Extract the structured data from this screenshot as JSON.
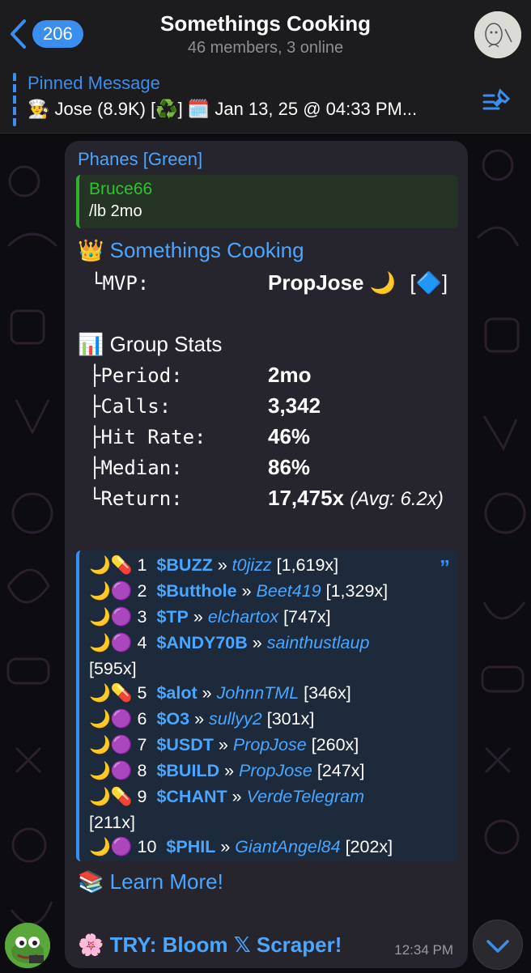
{
  "header": {
    "back_count": "206",
    "title": "Somethings Cooking",
    "subtitle": "46 members, 3 online"
  },
  "pinned": {
    "label": "Pinned Message",
    "text": "👨‍🍳 Jose (8.9K) [♻️] 🗓️ Jan 13, 25 @ 04:33 PM..."
  },
  "message": {
    "sender": "Phanes [Green]",
    "reply": {
      "name": "Bruce66",
      "text": "/lb 2mo"
    },
    "group_emoji": "👑",
    "group_name": "Somethings Cooking",
    "mvp": {
      "prefix": "└",
      "label": "MVP:",
      "value": "PropJose 🌙",
      "badge": "[🔷]"
    },
    "stats_emoji": "📊",
    "stats_title": "Group Stats",
    "stats": [
      {
        "prefix": "├",
        "label": "Period:",
        "value": "2mo"
      },
      {
        "prefix": "├",
        "label": "Calls:",
        "value": "3,342"
      },
      {
        "prefix": "├",
        "label": "Hit Rate:",
        "value": "46%"
      },
      {
        "prefix": "├",
        "label": "Median:",
        "value": "86%"
      },
      {
        "prefix": "└",
        "label": "Return:",
        "value": "17,475x",
        "extra": "(Avg: 6.2x)"
      }
    ],
    "leaderboard": [
      {
        "emojis": "🌙💊",
        "rank": "1",
        "ticker": "$BUZZ",
        "user": "t0jizz",
        "mult": "[1,619x]"
      },
      {
        "emojis": "🌙🟣",
        "rank": "2",
        "ticker": "$Butthole",
        "user": "Beet419",
        "mult": "[1,329x]"
      },
      {
        "emojis": "🌙🟣",
        "rank": "3",
        "ticker": "$TP",
        "user": "elchartox",
        "mult": "[747x]"
      },
      {
        "emojis": "🌙🟣",
        "rank": "4",
        "ticker": "$ANDY70B",
        "user": "sainthustlaup",
        "mult": "[595x]"
      },
      {
        "emojis": "🌙💊",
        "rank": "5",
        "ticker": "$alot",
        "user": "JohnnTML",
        "mult": "[346x]"
      },
      {
        "emojis": "🌙🟣",
        "rank": "6",
        "ticker": "$O3",
        "user": "sullyy2",
        "mult": "[301x]"
      },
      {
        "emojis": "🌙🟣",
        "rank": "7",
        "ticker": "$USDT",
        "user": "PropJose",
        "mult": "[260x]"
      },
      {
        "emojis": "🌙🟣",
        "rank": "8",
        "ticker": "$BUILD",
        "user": "PropJose",
        "mult": "[247x]"
      },
      {
        "emojis": "🌙💊",
        "rank": "9",
        "ticker": "$CHANT",
        "user": "VerdeTelegram",
        "mult": "[211x]"
      },
      {
        "emojis": "🌙🟣",
        "rank": "10",
        "ticker": "$PHIL",
        "user": "GiantAngel84",
        "mult": "[202x]"
      }
    ],
    "learn_emoji": "📚",
    "learn_more": "Learn More!",
    "try_emoji": "🌸",
    "try_text": "TRY: Bloom 𝕏 Scraper!",
    "time": "12:34 PM"
  },
  "colors": {
    "accent": "#3a8ef0",
    "link": "#4aa6ff",
    "reply_green": "#2fc32f",
    "bubble": "#26242c"
  }
}
